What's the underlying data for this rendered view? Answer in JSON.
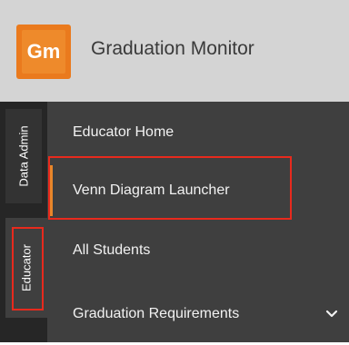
{
  "header": {
    "logo_text": "Gm",
    "app_title": "Graduation Monitor"
  },
  "rail": {
    "tabs": [
      {
        "label": "Data Admin"
      },
      {
        "label": "Educator"
      }
    ]
  },
  "menu": {
    "items": [
      {
        "label": "Educator Home"
      },
      {
        "label": "Venn Diagram Launcher"
      },
      {
        "label": "All Students"
      },
      {
        "label": "Graduation Requirements"
      }
    ]
  },
  "colors": {
    "accent": "#e8862a",
    "highlight": "#e82a1d",
    "sidebar": "#3f3f3f",
    "rail": "#262626",
    "header": "#d4d4d4"
  }
}
